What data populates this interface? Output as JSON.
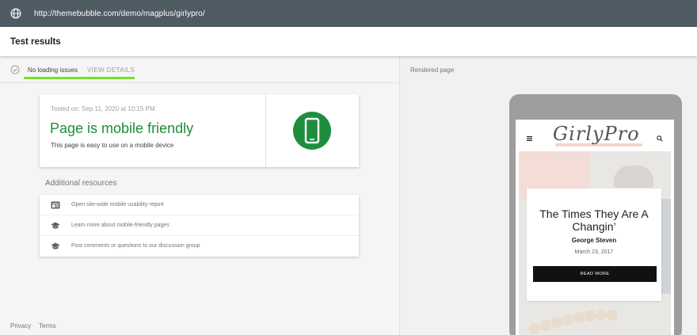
{
  "browser": {
    "url": "http://themebubble.com/demo/magplus/girlypro/",
    "globe_icon": "globe-icon"
  },
  "header": {
    "title": "Test results"
  },
  "status": {
    "text": "No loading issues",
    "view_details_label": "VIEW DETAILS",
    "icon": "check-circle-icon",
    "accent_color": "#76e22b"
  },
  "result": {
    "tested_on": "Tested on: Sep 11, 2020 at 10:15 PM",
    "heading": "Page is mobile friendly",
    "subtext": "This page is easy to use on a mobile device",
    "icon": "smartphone-icon",
    "color": "#1e8e3e"
  },
  "additional_resources": {
    "heading": "Additional resources",
    "items": [
      {
        "label": "Open site-wide mobile usability report",
        "icon": "report-icon"
      },
      {
        "label": "Learn more about mobile-friendly pages",
        "icon": "school-icon"
      },
      {
        "label": "Post comments or questions to our discussion group",
        "icon": "school-icon"
      }
    ]
  },
  "footer": {
    "privacy": "Privacy",
    "terms": "Terms"
  },
  "rendered": {
    "label": "Rendered page",
    "site": {
      "logo": "GirlyPro",
      "post_title": "The Times They Are A Changin’",
      "author": "George Steven",
      "date": "March 23, 2017",
      "read_more": "READ MORE"
    }
  }
}
